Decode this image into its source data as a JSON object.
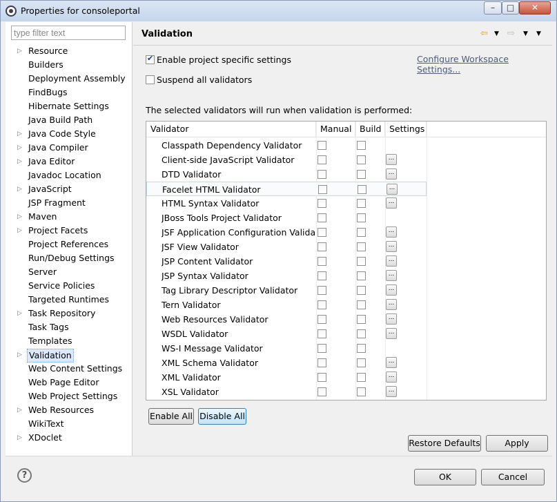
{
  "window": {
    "title": "Properties for consoleportal",
    "minimize": "–",
    "maximize": "□",
    "close": "✕"
  },
  "filter": {
    "placeholder": "type filter text",
    "value": ""
  },
  "tree": [
    {
      "label": "Resource",
      "expandable": true
    },
    {
      "label": "Builders",
      "expandable": false
    },
    {
      "label": "Deployment Assembly",
      "expandable": false
    },
    {
      "label": "FindBugs",
      "expandable": false
    },
    {
      "label": "Hibernate Settings",
      "expandable": false
    },
    {
      "label": "Java Build Path",
      "expandable": false
    },
    {
      "label": "Java Code Style",
      "expandable": true
    },
    {
      "label": "Java Compiler",
      "expandable": true
    },
    {
      "label": "Java Editor",
      "expandable": true
    },
    {
      "label": "Javadoc Location",
      "expandable": false
    },
    {
      "label": "JavaScript",
      "expandable": true
    },
    {
      "label": "JSP Fragment",
      "expandable": false
    },
    {
      "label": "Maven",
      "expandable": true
    },
    {
      "label": "Project Facets",
      "expandable": true
    },
    {
      "label": "Project References",
      "expandable": false
    },
    {
      "label": "Run/Debug Settings",
      "expandable": false
    },
    {
      "label": "Server",
      "expandable": false
    },
    {
      "label": "Service Policies",
      "expandable": false
    },
    {
      "label": "Targeted Runtimes",
      "expandable": false
    },
    {
      "label": "Task Repository",
      "expandable": true
    },
    {
      "label": "Task Tags",
      "expandable": false
    },
    {
      "label": "Templates",
      "expandable": false
    },
    {
      "label": "Validation",
      "expandable": true,
      "selected": true
    },
    {
      "label": "Web Content Settings",
      "expandable": false
    },
    {
      "label": "Web Page Editor",
      "expandable": false
    },
    {
      "label": "Web Project Settings",
      "expandable": false
    },
    {
      "label": "Web Resources",
      "expandable": true
    },
    {
      "label": "WikiText",
      "expandable": false
    },
    {
      "label": "XDoclet",
      "expandable": true
    }
  ],
  "page": {
    "title": "Validation",
    "enable_project_label": "Enable project specific settings",
    "enable_project_checked": true,
    "configure_link": "Configure Workspace Settings...",
    "suspend_label": "Suspend all validators",
    "suspend_checked": false,
    "info_text": "The selected validators will run when validation is performed:"
  },
  "table": {
    "headers": {
      "validator": "Validator",
      "manual": "Manual",
      "build": "Build",
      "settings": "Settings"
    },
    "rows": [
      {
        "name": "Classpath Dependency Validator",
        "settings": false
      },
      {
        "name": "Client-side JavaScript Validator",
        "settings": true
      },
      {
        "name": "DTD Validator",
        "settings": true
      },
      {
        "name": "Facelet HTML Validator",
        "settings": true,
        "highlight": true
      },
      {
        "name": "HTML Syntax Validator",
        "settings": true
      },
      {
        "name": "JBoss Tools Project Validator",
        "settings": false
      },
      {
        "name": "JSF Application Configuration Valida...",
        "settings": true
      },
      {
        "name": "JSF View Validator",
        "settings": true
      },
      {
        "name": "JSP Content Validator",
        "settings": true
      },
      {
        "name": "JSP Syntax Validator",
        "settings": true
      },
      {
        "name": "Tag Library Descriptor Validator",
        "settings": true
      },
      {
        "name": "Tern Validator",
        "settings": true
      },
      {
        "name": "Web Resources Validator",
        "settings": true
      },
      {
        "name": "WSDL Validator",
        "settings": true
      },
      {
        "name": "WS-I Message Validator",
        "settings": false
      },
      {
        "name": "XML Schema Validator",
        "settings": true
      },
      {
        "name": "XML Validator",
        "settings": true
      },
      {
        "name": "XSL Validator",
        "settings": true
      }
    ],
    "settings_glyph": "..."
  },
  "buttons": {
    "enable_all": "Enable All",
    "disable_all": "Disable All",
    "restore_defaults": "Restore Defaults",
    "apply": "Apply",
    "ok": "OK",
    "cancel": "Cancel",
    "help": "?"
  }
}
